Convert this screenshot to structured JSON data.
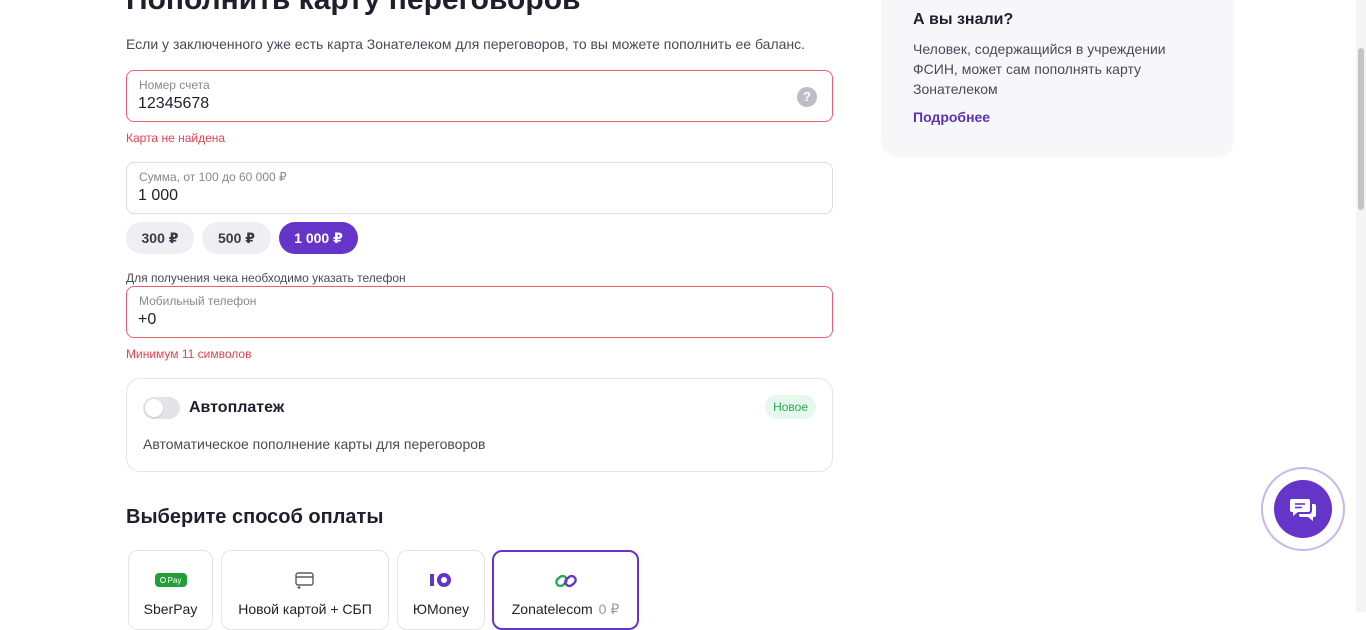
{
  "page": {
    "title": "Пополнить карту переговоров",
    "intro": "Если у заключенного уже есть карта Зонателеком для переговоров, то вы можете пополнить ее баланс."
  },
  "account_field": {
    "label": "Номер счета",
    "value": "12345678",
    "help_icon": "?",
    "error": "Карта не найдена"
  },
  "amount_field": {
    "label": "Сумма, от 100 до 60 000 ₽",
    "value": "1 000"
  },
  "amount_chips": [
    {
      "label": "300 ₽",
      "active": false
    },
    {
      "label": "500 ₽",
      "active": false
    },
    {
      "label": "1 000 ₽",
      "active": true
    }
  ],
  "phone_field": {
    "hint": "Для получения чека необходимо указать телефон",
    "label": "Мобильный телефон",
    "value": "+0",
    "error": "Минимум 11 символов"
  },
  "autopay": {
    "title": "Автоплатеж",
    "badge": "Новое",
    "description": "Автоматическое пополнение карты для переговоров",
    "enabled": false
  },
  "payment": {
    "title": "Выберите способ оплаты",
    "methods": [
      {
        "label": "SberPay",
        "icon": "sberpay-icon",
        "icon_text": "Pay",
        "note": "",
        "selected": false
      },
      {
        "label": "Новой картой + СБП",
        "icon": "new-card-icon",
        "note": "",
        "selected": false
      },
      {
        "label": "ЮMoney",
        "icon": "yumoney-icon",
        "note": "",
        "selected": false
      },
      {
        "label": "Zonatelecom",
        "icon": "zonatelecom-icon",
        "note": "0 ₽",
        "selected": true
      }
    ]
  },
  "info": {
    "title": "А вы знали?",
    "text": "Человек, содержащийся в учреждении ФСИН, может сам пополнять карту Зонателеком",
    "link": "Подробнее"
  },
  "colors": {
    "accent": "#6534c8",
    "error": "#e5414f",
    "badge_green": "#2fa45c",
    "sber_green": "#21a038"
  }
}
